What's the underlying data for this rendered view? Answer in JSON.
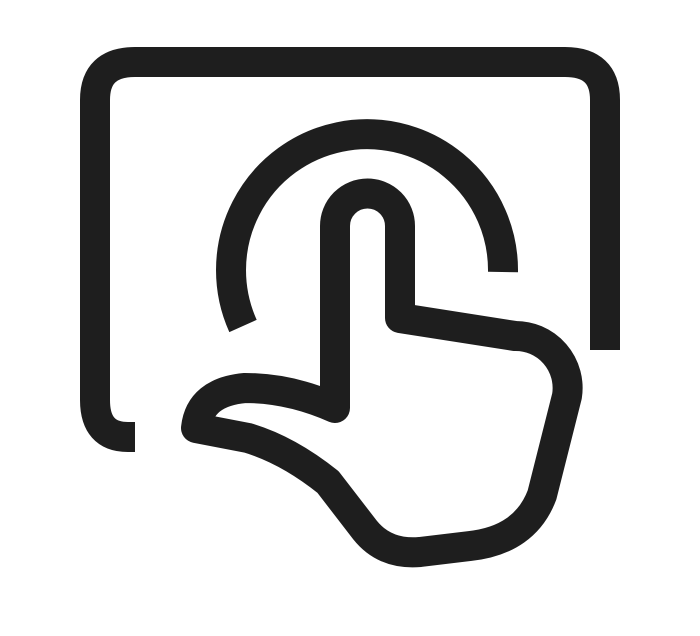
{
  "icon": {
    "name": "touch-screen-tap-icon",
    "stroke_color": "#1e1e1e",
    "background_color": "#ffffff"
  }
}
